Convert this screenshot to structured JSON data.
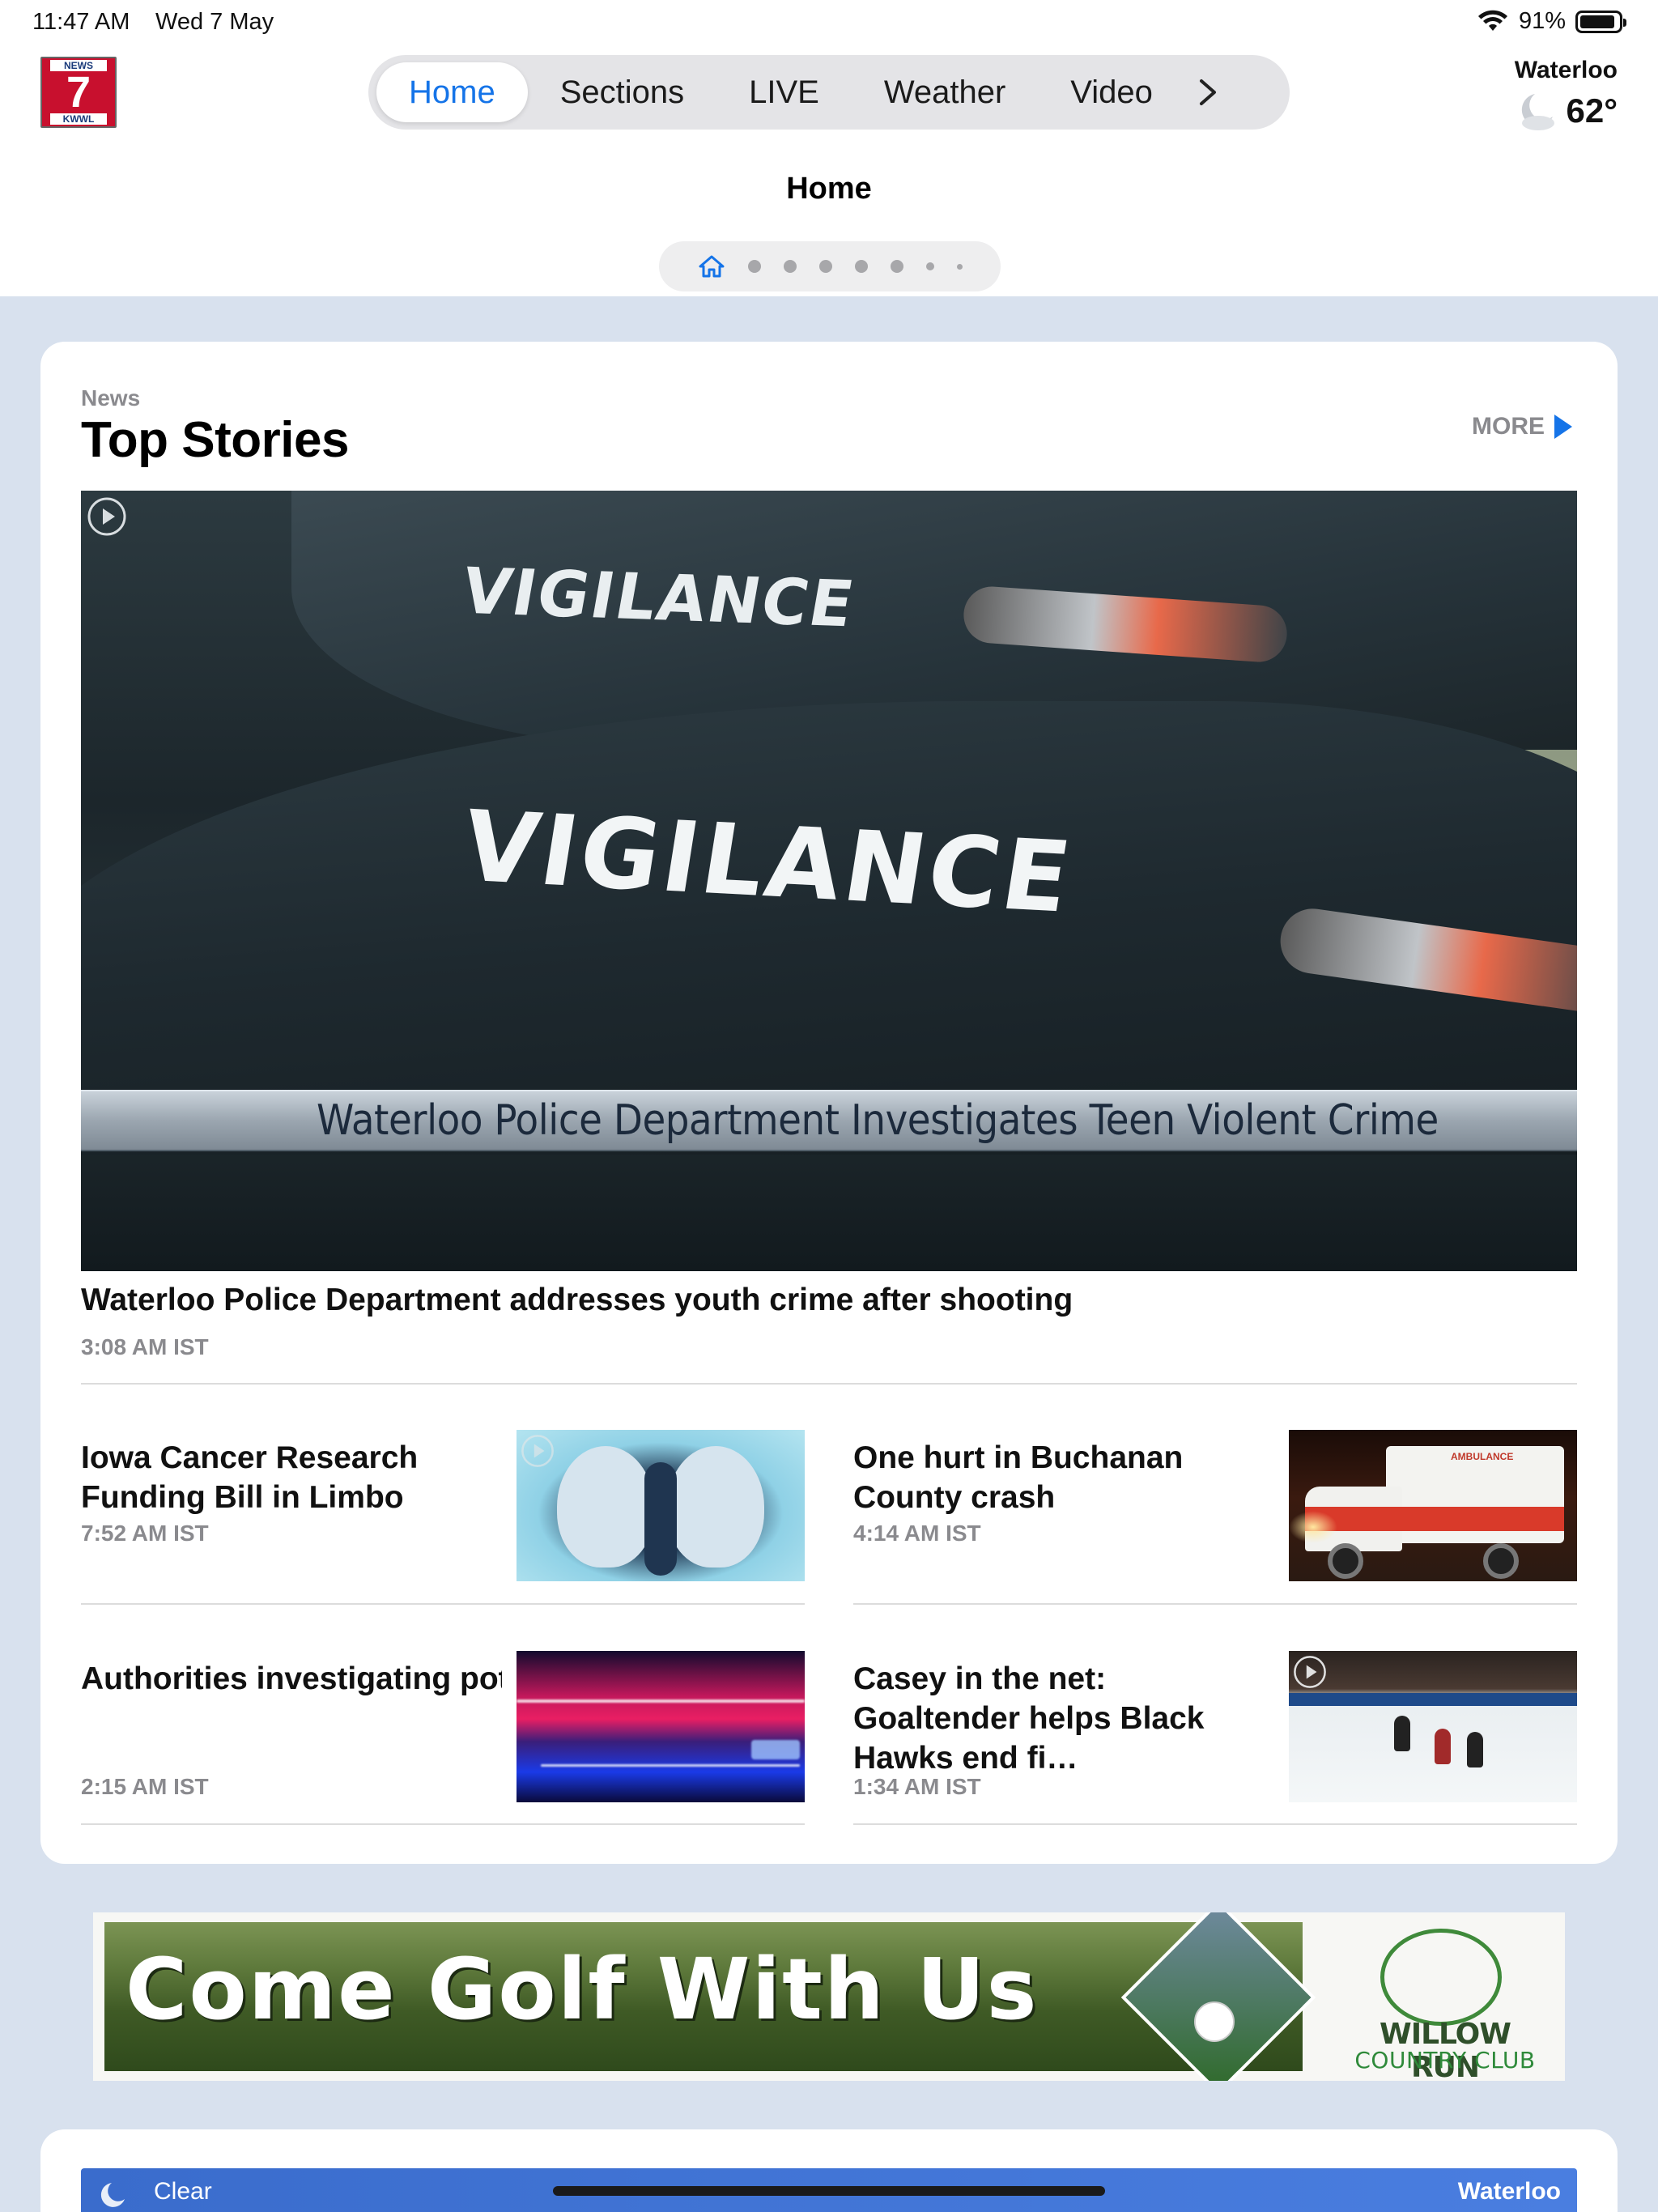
{
  "status_bar": {
    "time": "11:47 AM",
    "date": "Wed 7 May",
    "battery": "91%",
    "battery_level": 0.91
  },
  "logo": {
    "top": "NEWS",
    "number": "7",
    "bottom": "KWWL"
  },
  "nav": {
    "tabs": [
      "Home",
      "Sections",
      "LIVE",
      "Weather",
      "Video"
    ],
    "active_tab": "Home",
    "more_icon": "chevron-right-icon"
  },
  "weather_widget": {
    "city": "Waterloo",
    "temp": "62°",
    "icon": "moon-cloud-icon"
  },
  "page": {
    "title": "Home",
    "dots_count": 7,
    "active_page": 1
  },
  "top_stories": {
    "kicker": "News",
    "title": "Top Stories",
    "more": "MORE",
    "hero": {
      "image_text_1": "VIGILANCE",
      "image_text_2": "VIGILANCE",
      "lower_third": "Waterloo Police Department Investigates Teen Violent Crime",
      "headline": "Waterloo Police Department addresses youth crime after shooting",
      "time": "3:08 AM IST",
      "has_video": true
    },
    "stories": [
      {
        "title": "Iowa Cancer Research Funding Bill in Limbo",
        "time": "7:52 AM IST",
        "thumb": "lung-scan",
        "has_video": true
      },
      {
        "title": "One hurt in Buchanan County crash",
        "time": "4:14 AM IST",
        "thumb": "ambulance",
        "has_video": false,
        "thumb_text": "AMBULANCE"
      },
      {
        "title": "Authorities investigating potential threat in Benton…",
        "time": "2:15 AM IST",
        "thumb": "police-lights",
        "has_video": false
      },
      {
        "title": "Casey in the net: Goaltender helps Black Hawks end fi…",
        "time": "1:34 AM IST",
        "thumb": "hockey",
        "has_video": true
      }
    ]
  },
  "ad": {
    "headline": "Come Golf With Us",
    "brand_line1": "WILLOW RUN",
    "brand_line2": "COUNTRY CLUB"
  },
  "weather_bar": {
    "condition": "Clear",
    "city": "Waterloo"
  },
  "colors": {
    "accent": "#1574e8",
    "background": "#d8e1ee",
    "muted": "#8a8a8e"
  }
}
